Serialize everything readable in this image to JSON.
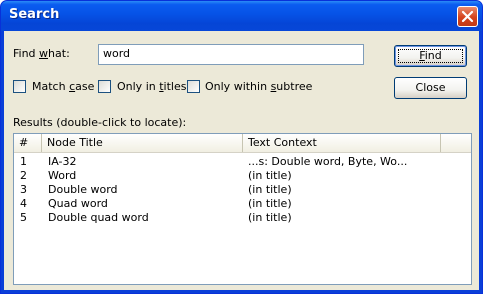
{
  "window": {
    "title": "Search"
  },
  "find": {
    "label_prefix": "Find ",
    "label_accel": "w",
    "label_suffix": "hat:",
    "value": "word"
  },
  "buttons": {
    "find_accel": "F",
    "find_rest": "ind",
    "close_label": "Close"
  },
  "options": {
    "match_case_prefix": "Match ",
    "match_case_accel": "c",
    "match_case_suffix": "ase",
    "only_titles_prefix": "Only in ",
    "only_titles_accel": "t",
    "only_titles_suffix": "itles",
    "only_subtree_prefix": "Only within ",
    "only_subtree_accel": "s",
    "only_subtree_suffix": "ubtree"
  },
  "results": {
    "label": "Results (double-click to locate):",
    "columns": [
      "#",
      "Node Title",
      "Text Context"
    ],
    "rows": [
      {
        "num": "1",
        "title": "IA-32",
        "context": "...s: Double word, Byte, Wo..."
      },
      {
        "num": "2",
        "title": "Word",
        "context": "(in title)"
      },
      {
        "num": "3",
        "title": "Double word",
        "context": "(in title)"
      },
      {
        "num": "4",
        "title": "Quad word",
        "context": "(in title)"
      },
      {
        "num": "5",
        "title": "Double quad word",
        "context": "(in title)"
      }
    ]
  }
}
